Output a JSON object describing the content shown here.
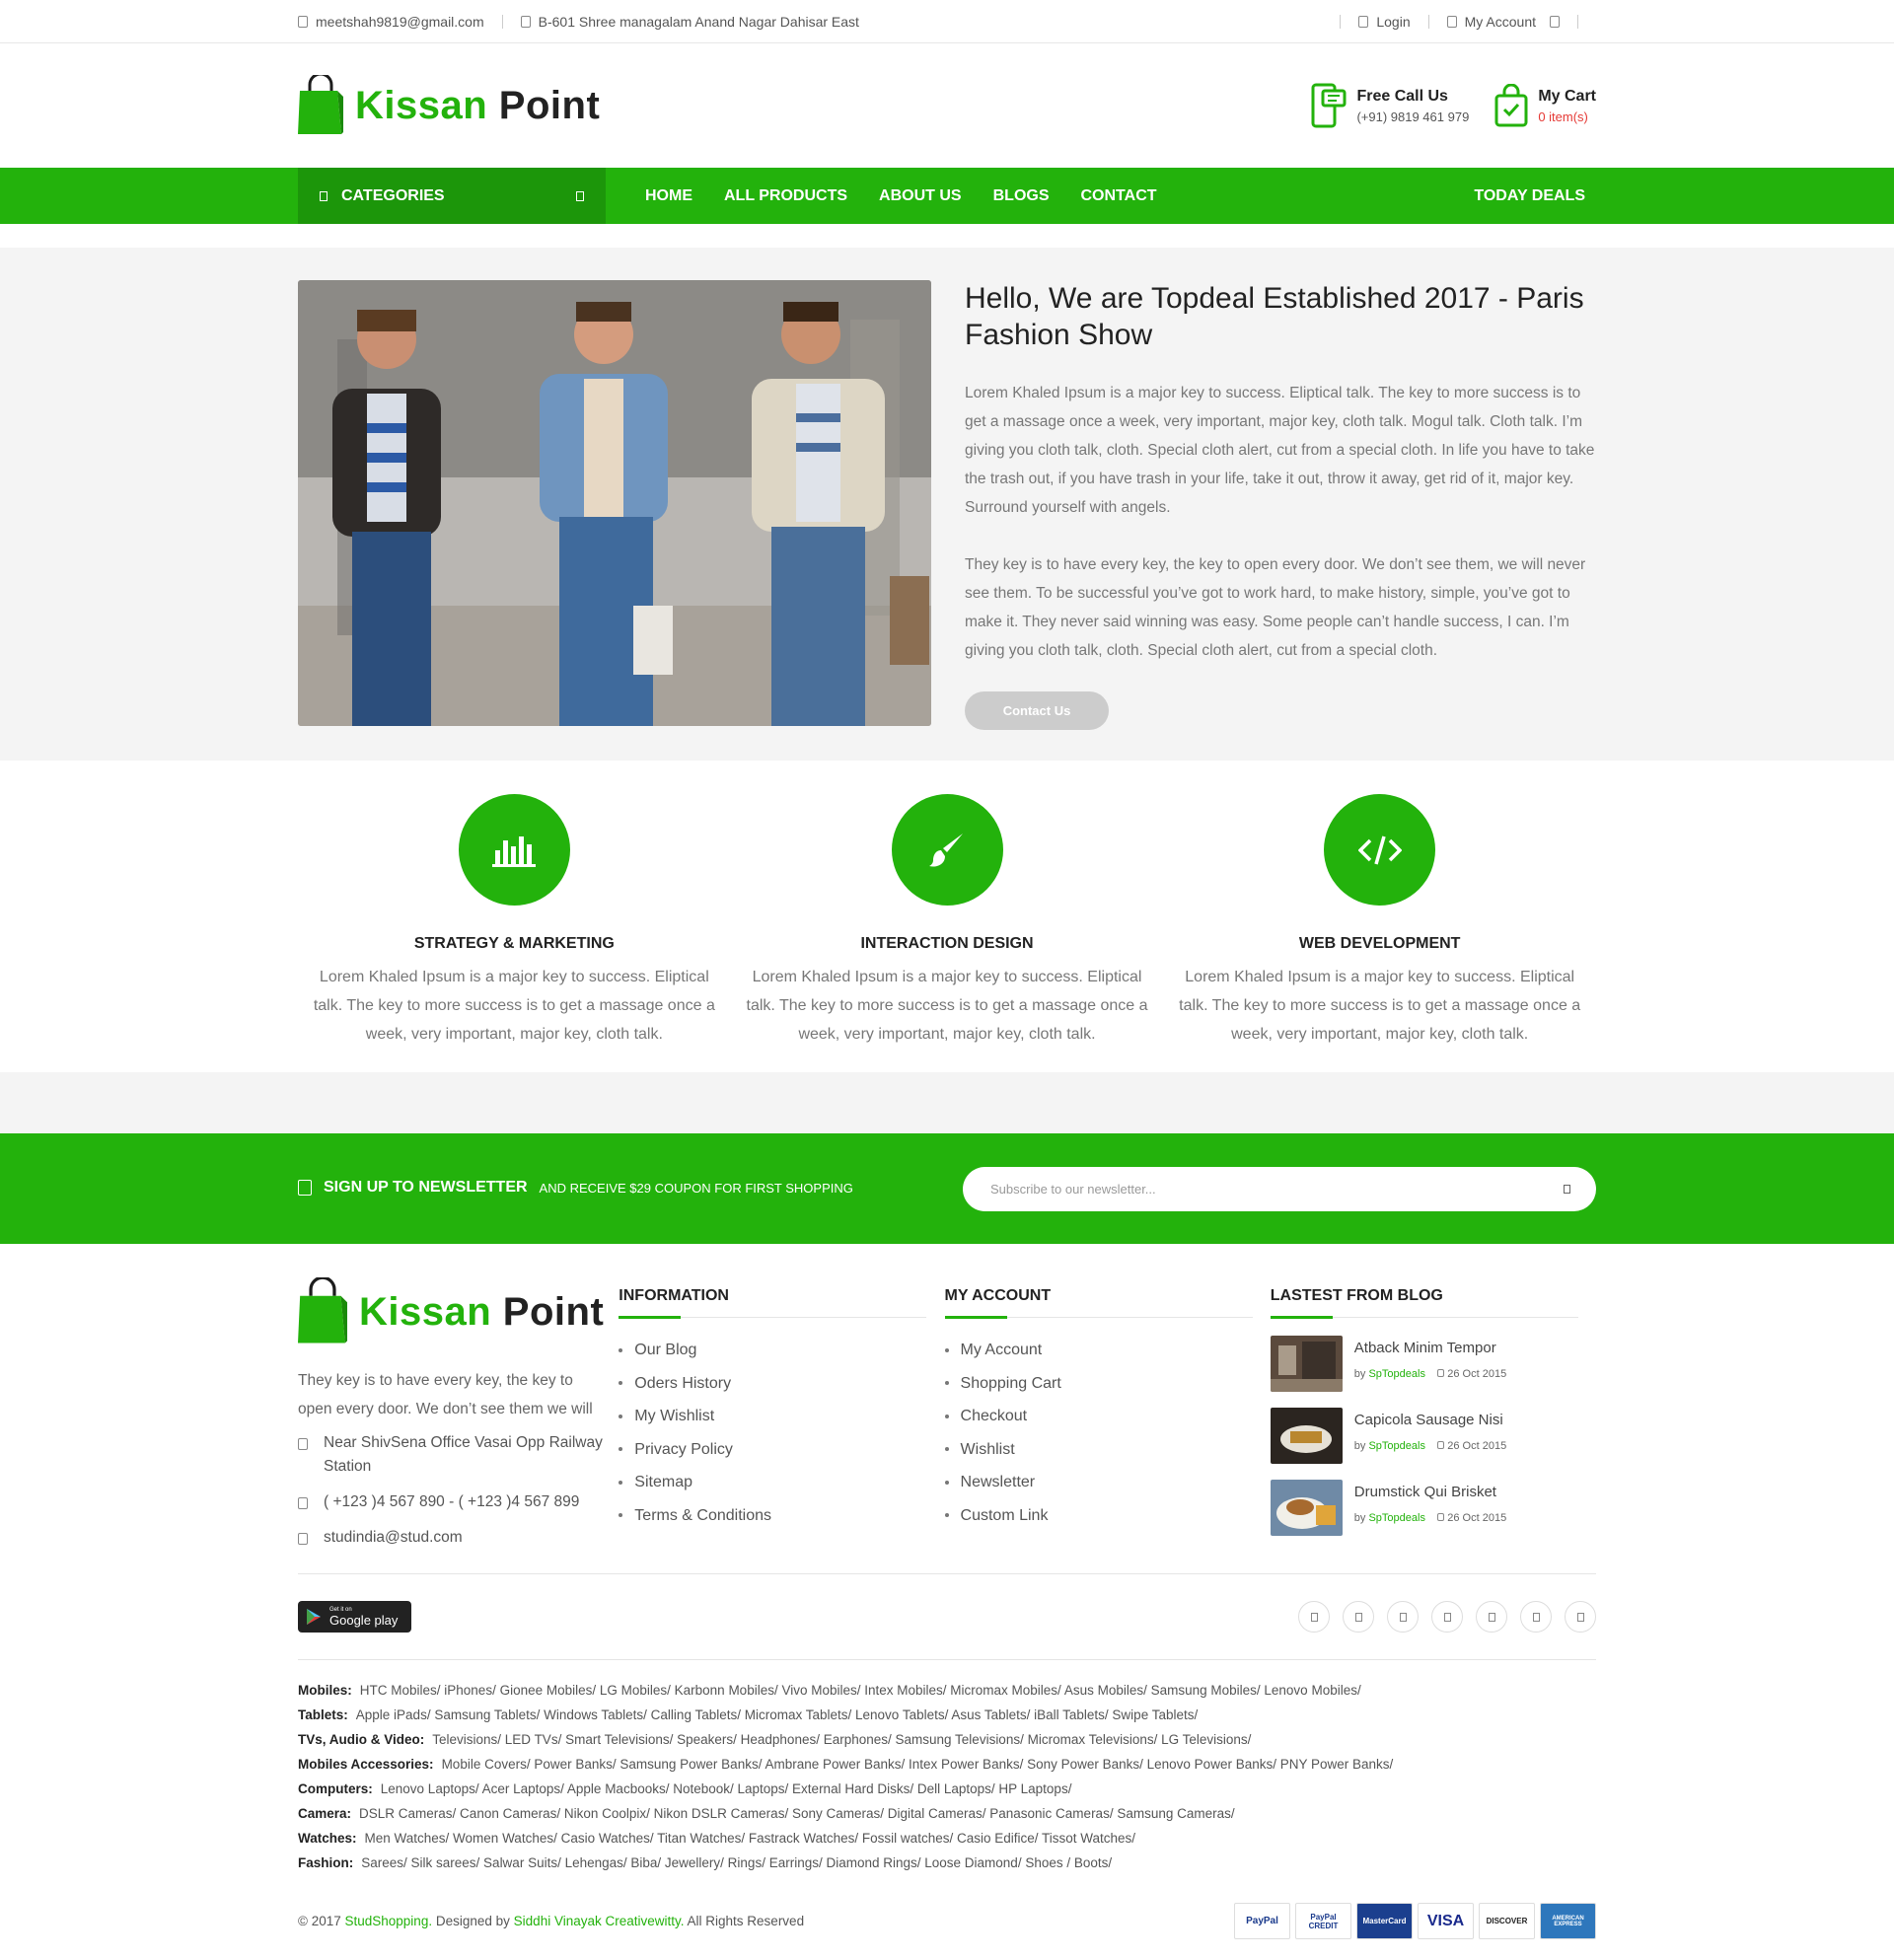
{
  "topbar": {
    "email": "meetshah9819@gmail.com",
    "address": "B-601 Shree managalam Anand Nagar Dahisar East",
    "login": "Login",
    "account": "My Account"
  },
  "brand": {
    "word1": "Kissan",
    "word2": "Point",
    "color": "#23b20c"
  },
  "header": {
    "call_title": "Free Call Us",
    "call_number": "(+91) 9819 461 979",
    "cart_title": "My Cart",
    "cart_count": "0 item(s)"
  },
  "nav": {
    "categories": "CATEGORIES",
    "items": [
      "HOME",
      "ALL PRODUCTS",
      "ABOUT US",
      "BLOGS",
      "CONTACT"
    ],
    "deals": "TODAY DEALS"
  },
  "hero": {
    "title": "Hello, We are Topdeal Established 2017 - Paris Fashion Show",
    "p1": "Lorem Khaled Ipsum is a major key to success. Eliptical talk. The key to more success is to get a massage once a week, very important, major key, cloth talk. Mogul talk. Cloth talk. I’m giving you cloth talk, cloth. Special cloth alert, cut from a special cloth. In life you have to take the trash out, if you have trash in your life, take it out, throw it away, get rid of it, major key. Surround yourself with angels.",
    "p2": "They key is to have every key, the key to open every door. We don’t see them, we will never see them. To be successful you’ve got to work hard, to make history, simple, you’ve got to make it. They never said winning was easy. Some people can’t handle success, I can. I’m giving you cloth talk, cloth. Special cloth alert, cut from a special cloth.",
    "button": "Contact Us"
  },
  "features": [
    {
      "title": "STRATEGY & MARKETING",
      "text": "Lorem Khaled Ipsum is a major key to success. Eliptical talk. The key to more success is to get a massage once a week, very important, major key, cloth talk.",
      "icon": "bar-chart-icon"
    },
    {
      "title": "INTERACTION DESIGN",
      "text": "Lorem Khaled Ipsum is a major key to success. Eliptical talk. The key to more success is to get a massage once a week, very important, major key, cloth talk.",
      "icon": "paint-brush-icon"
    },
    {
      "title": "WEB DEVELOPMENT",
      "text": "Lorem Khaled Ipsum is a major key to success. Eliptical talk. The key to more success is to get a massage once a week, very important, major key, cloth talk.",
      "icon": "code-icon"
    }
  ],
  "newsletter": {
    "strong": "SIGN UP TO NEWSLETTER",
    "rest": "AND RECEIVE $29 COUPON FOR FIRST SHOPPING",
    "placeholder": "Subscribe to our newsletter..."
  },
  "footer": {
    "about": "They key is to have every key, the key to open every door. We don’t see them we will",
    "address": "Near ShivSena Office Vasai Opp Railway Station",
    "phone": "( +123 )4 567 890 - ( +123 )4 567 899",
    "email": "studindia@stud.com",
    "info_title": "INFORMATION",
    "info": [
      "Our Blog",
      "Oders History",
      "My Wishlist",
      "Privacy Policy",
      "Sitemap",
      "Terms & Conditions"
    ],
    "account_title": "MY ACCOUNT",
    "account": [
      "My Account",
      "Shopping Cart",
      "Checkout",
      "Wishlist",
      "Newsletter",
      "Custom Link"
    ],
    "blog_title": "LASTEST FROM BLOG",
    "blog": [
      {
        "title": "Atback Minim Tempor",
        "by": "by",
        "author": "SpTopdeals",
        "date": "26 Oct 2015"
      },
      {
        "title": "Capicola Sausage Nisi",
        "by": "by",
        "author": "SpTopdeals",
        "date": "26 Oct 2015"
      },
      {
        "title": "Drumstick Qui Brisket",
        "by": "by",
        "author": "SpTopdeals",
        "date": "26 Oct 2015"
      }
    ],
    "gplay_small": "Get it on",
    "gplay_big": "Google play"
  },
  "links": [
    {
      "label": "Mobiles:",
      "items": "HTC Mobiles/ iPhones/ Gionee Mobiles/ LG Mobiles/ Karbonn Mobiles/ Vivo Mobiles/ Intex Mobiles/ Micromax Mobiles/ Asus Mobiles/ Samsung Mobiles/ Lenovo Mobiles/"
    },
    {
      "label": "Tablets:",
      "items": "Apple iPads/ Samsung Tablets/ Windows Tablets/ Calling Tablets/ Micromax Tablets/ Lenovo Tablets/ Asus Tablets/ iBall Tablets/ Swipe Tablets/"
    },
    {
      "label": "TVs, Audio & Video:",
      "items": "Televisions/ LED TVs/ Smart Televisions/ Speakers/ Headphones/ Earphones/ Samsung Televisions/ Micromax Televisions/ LG Televisions/"
    },
    {
      "label": "Mobiles Accessories:",
      "items": "Mobile Covers/ Power Banks/ Samsung Power Banks/ Ambrane Power Banks/ Intex Power Banks/ Sony Power Banks/ Lenovo Power Banks/ PNY Power Banks/"
    },
    {
      "label": "Computers:",
      "items": "Lenovo Laptops/ Acer Laptops/ Apple Macbooks/ Notebook/ Laptops/ External Hard Disks/ Dell Laptops/ HP Laptops/"
    },
    {
      "label": "Camera:",
      "items": "DSLR Cameras/ Canon Cameras/ Nikon Coolpix/ Nikon DSLR Cameras/ Sony Cameras/ Digital Cameras/ Panasonic Cameras/ Samsung Cameras/"
    },
    {
      "label": "Watches:",
      "items": "Men Watches/ Women Watches/ Casio Watches/ Titan Watches/ Fastrack Watches/ Fossil watches/ Casio Edifice/ Tissot Watches/"
    },
    {
      "label": "Fashion:",
      "items": "Sarees/ Silk sarees/ Salwar Suits/ Lehengas/ Biba/ Jewellery/ Rings/ Earrings/ Diamond Rings/ Loose Diamond/ Shoes / Boots/"
    }
  ],
  "copyright": {
    "pre": "© 2017",
    "site": "StudShopping.",
    "mid": "Designed by",
    "designer": "Siddhi Vinayak Creativewitty.",
    "post": "All Rights Reserved"
  },
  "payments": [
    "PayPal",
    "PayPal CREDIT",
    "MasterCard",
    "VISA",
    "DISCOVER",
    "AMERICAN EXPRESS"
  ]
}
